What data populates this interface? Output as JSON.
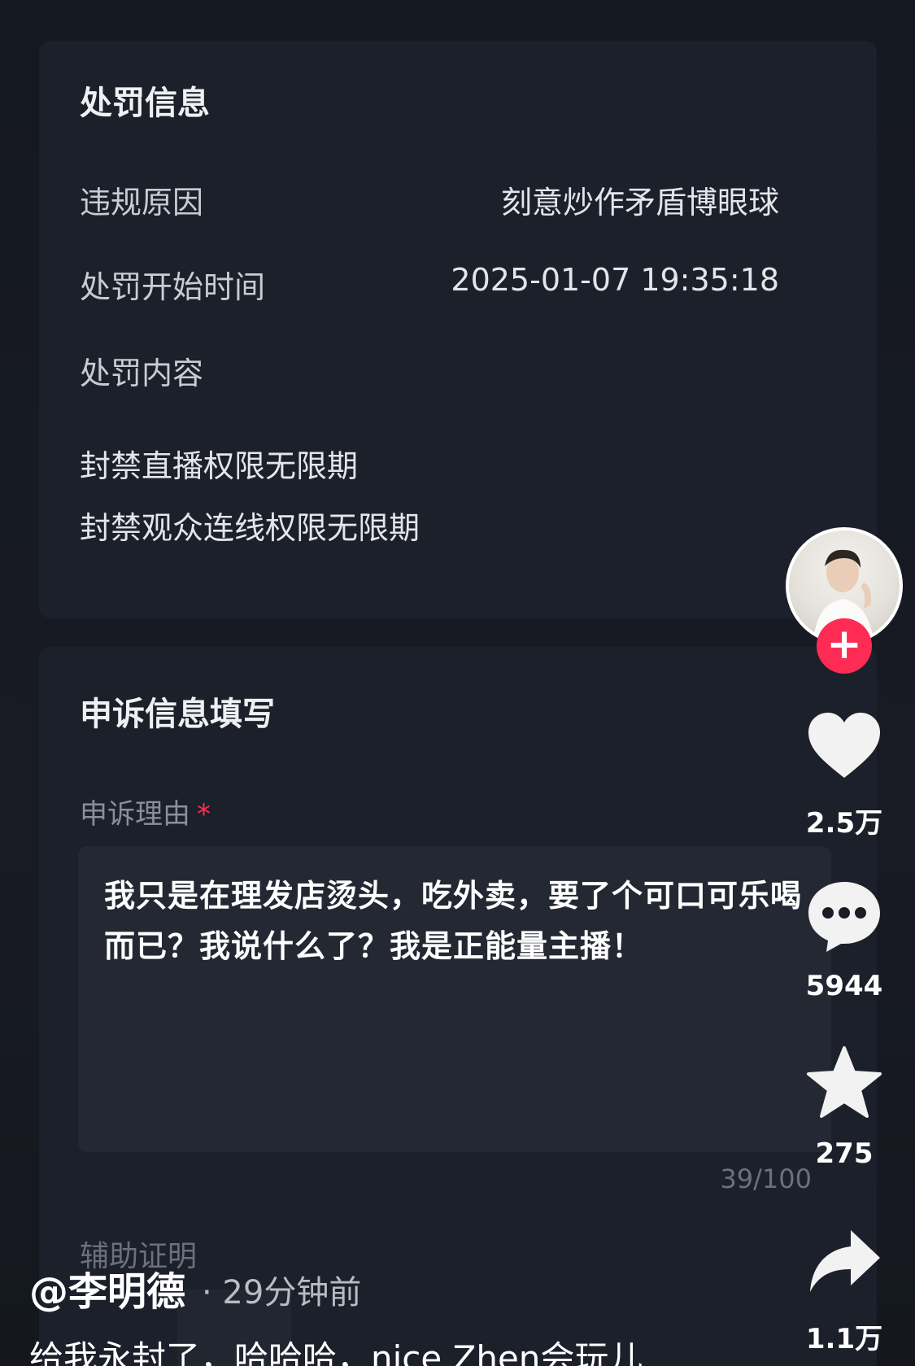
{
  "penalty": {
    "title": "处罚信息",
    "rows": [
      {
        "label": "违规原因",
        "value": "刻意炒作矛盾博眼球"
      },
      {
        "label": "处罚开始时间",
        "value": "2025-01-07 19:35:18"
      },
      {
        "label": "处罚内容",
        "value": ""
      }
    ],
    "content": [
      "封禁直播权限无限期",
      "封禁观众连线权限无限期"
    ]
  },
  "appeal": {
    "title": "申诉信息填写",
    "reason_label": "申诉理由",
    "required_mark": "*",
    "reason_text": "我只是在理发店烫头，吃外卖，要了个可口可乐喝而已？我说什么了？我是正能量主播！",
    "counter": "39/100",
    "aux_label": "辅助证明"
  },
  "rail": {
    "follow_label": "+",
    "likes": "2.5万",
    "comments": "5944",
    "favorites": "275",
    "shares": "1.1万",
    "icons": [
      "avatar",
      "heart-icon",
      "comment-icon",
      "star-icon",
      "share-icon"
    ]
  },
  "post": {
    "author": "@李明德",
    "meta": "· 29分钟前",
    "caption": "给我永封了，哈哈哈，nice Zhen会玩儿"
  },
  "colors": {
    "accent": "#fe2c55",
    "background": "#15181f",
    "card": "#1c202a"
  }
}
